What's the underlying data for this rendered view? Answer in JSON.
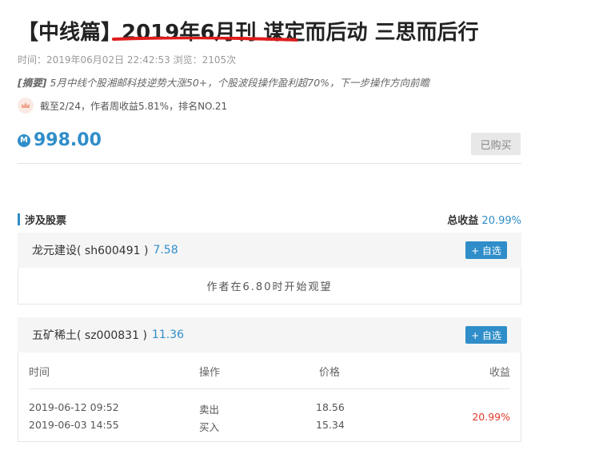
{
  "article": {
    "title": "【中线篇】2019年6月刊 谋定而后动 三思而后行",
    "meta": "时间：2019年06月02日 22:42:53  浏览：2105次",
    "summary_tag": "[摘要]",
    "summary_text": " 5月中线个股湘邮科技逆势大涨50+，个股波段操作盈利超70%，下一步操作方向前瞻",
    "rank_text": "截至2/24，作者周收益5.81%，排名NO.21",
    "price": "998.00",
    "coin_symbol": "M",
    "bought_label": "已购买"
  },
  "stocks_section": {
    "title": "涉及股票",
    "total_label": "总收益",
    "total_value": "20.99%"
  },
  "stocks": [
    {
      "name": "龙元建设( sh600491 )",
      "price": "7.58",
      "add_label": "+ 自选",
      "note": "作者在6.80时开始观望"
    },
    {
      "name": "五矿稀土( sz000831 )",
      "price": "11.36",
      "add_label": "+ 自选",
      "columns": [
        "时间",
        "操作",
        "价格",
        "收益"
      ],
      "trades": [
        {
          "time": "2019-06-12 09:52",
          "op": "卖出",
          "price": "18.56"
        },
        {
          "time": "2019-06-03 14:55",
          "op": "买入",
          "price": "15.34"
        }
      ],
      "profit": "20.99%"
    }
  ],
  "colors": {
    "accent": "#2f8ec9",
    "profit": "#e0392b",
    "underline": "#e01b1b"
  }
}
